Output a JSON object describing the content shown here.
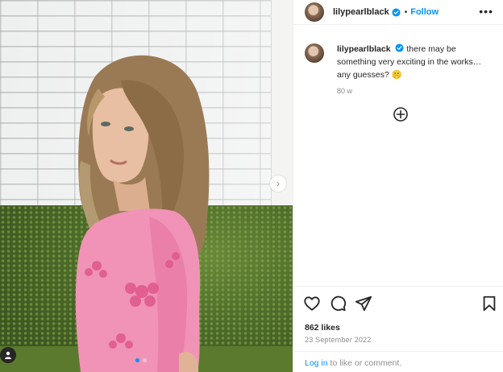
{
  "post": {
    "username": "lilypearlblack",
    "follow_label": "Follow",
    "separator": "•",
    "more_label": "•••",
    "caption_text": "there may be something very exciting in the works… any guesses? 🤫",
    "caption_time": "80 w",
    "likes_text": "862 likes",
    "date_text": "23 September 2022",
    "login_link": "Log in",
    "login_suffix": " to like or comment."
  },
  "media": {
    "next_glyph": "›",
    "slide_count": 2,
    "active_slide": 1
  },
  "colors": {
    "accent": "#0095f6",
    "text": "#262626",
    "muted": "#8e8e8e",
    "divider": "#efefef"
  },
  "icons": [
    "verified-badge-icon",
    "more-options-icon",
    "add-comment-icon",
    "heart-icon",
    "comment-icon",
    "share-icon",
    "bookmark-icon",
    "chevron-right-icon",
    "user-tag-icon"
  ]
}
